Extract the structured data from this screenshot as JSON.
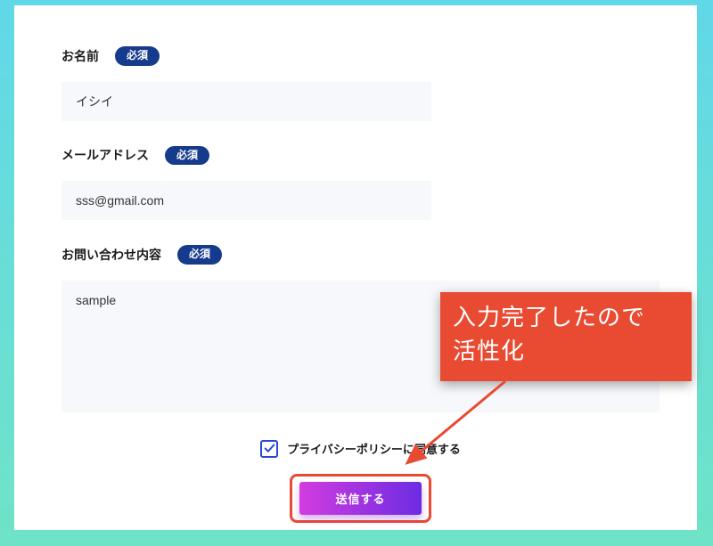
{
  "form": {
    "name": {
      "label": "お名前",
      "badge": "必須",
      "value": "イシイ"
    },
    "email": {
      "label": "メールアドレス",
      "badge": "必須",
      "value": "sss@gmail.com"
    },
    "inquiry": {
      "label": "お問い合わせ内容",
      "badge": "必須",
      "value": "sample"
    },
    "privacy": {
      "label": "プライバシーポリシーに同意する",
      "checked": true
    },
    "submit": {
      "label": "送信する"
    }
  },
  "annotation": {
    "callout_line1": "入力完了したので",
    "callout_line2": "活性化"
  },
  "colors": {
    "badge_bg": "#163a8c",
    "accent_border": "#e94a32",
    "btn_grad_start": "#d23ce0",
    "btn_grad_end": "#6c2ce2",
    "checkbox_border": "#2749d6"
  }
}
